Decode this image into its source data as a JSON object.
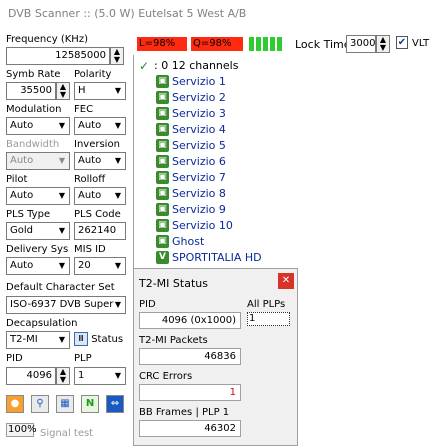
{
  "window": {
    "title": "DVB Scanner :: (5.0 W) Eutelsat 5 West A/B"
  },
  "status_bars": {
    "level": "L=98%",
    "quality": "Q=98%"
  },
  "lock_time": {
    "label": "Lock Time",
    "value": "3000",
    "vlt_label": "VLT"
  },
  "form": {
    "frequency": {
      "label": "Frequency (KHz)",
      "value": "12585000"
    },
    "symbol_rate": {
      "label": "Symb Rate",
      "value": "35500"
    },
    "polarity": {
      "label": "Polarity",
      "value": "H"
    },
    "modulation": {
      "label": "Modulation",
      "value": "Auto"
    },
    "fec": {
      "label": "FEC",
      "value": "Auto"
    },
    "bandwidth": {
      "label": "Bandwidth",
      "value": "Auto"
    },
    "inversion": {
      "label": "Inversion",
      "value": "Auto"
    },
    "pilot": {
      "label": "Pilot",
      "value": "Auto"
    },
    "rolloff": {
      "label": "Rolloff",
      "value": "Auto"
    },
    "pls_type": {
      "label": "PLS Type",
      "value": "Gold"
    },
    "pls_code": {
      "label": "PLS Code",
      "value": "262140"
    },
    "delivery_sys": {
      "label": "Delivery Sys",
      "value": "Auto"
    },
    "mis_id": {
      "label": "MIS ID",
      "value": "20"
    },
    "charset": {
      "label": "Default Character Set",
      "value": "ISO-6937 DVB Super"
    },
    "decapsulation": {
      "label": "Decapsulation",
      "value": "T2-MI",
      "status_label": "Status"
    },
    "pid": {
      "label": "PID",
      "value": "4096"
    },
    "plp": {
      "label": "PLP",
      "value": "1"
    }
  },
  "bottom": {
    "zoom": "100%",
    "signal_test": "Signal test"
  },
  "channel_list": {
    "header": ": 0 12 channels",
    "channels": [
      {
        "name": "Servizio 1",
        "icon": "tv"
      },
      {
        "name": "Servizio 2",
        "icon": "tv"
      },
      {
        "name": "Servizio 3",
        "icon": "tv"
      },
      {
        "name": "Servizio 4",
        "icon": "tv"
      },
      {
        "name": "Servizio 5",
        "icon": "tv"
      },
      {
        "name": "Servizio 6",
        "icon": "tv"
      },
      {
        "name": "Servizio 7",
        "icon": "tv"
      },
      {
        "name": "Servizio 8",
        "icon": "tv"
      },
      {
        "name": "Servizio 9",
        "icon": "tv"
      },
      {
        "name": "Servizio 10",
        "icon": "tv"
      },
      {
        "name": "Ghost",
        "icon": "tv"
      },
      {
        "name": "SPORTITALIA HD",
        "icon": "V"
      }
    ]
  },
  "t2mi": {
    "title": "T2-MI Status",
    "pid_label": "PID",
    "pid_value": "4096 (0x1000)",
    "all_plps_label": "All PLPs",
    "all_plps_value": "1",
    "packets_label": "T2-MI Packets",
    "packets_value": "46836",
    "crc_label": "CRC Errors",
    "crc_value": "1",
    "bb_label": "BB Frames | PLP 1",
    "bb_value": "46302"
  },
  "colors": {
    "level_bar": "#ff2a10",
    "quality_bar": "#ff2a10",
    "signal_green": "#2fcc2f",
    "crc_value": "#e00000"
  }
}
